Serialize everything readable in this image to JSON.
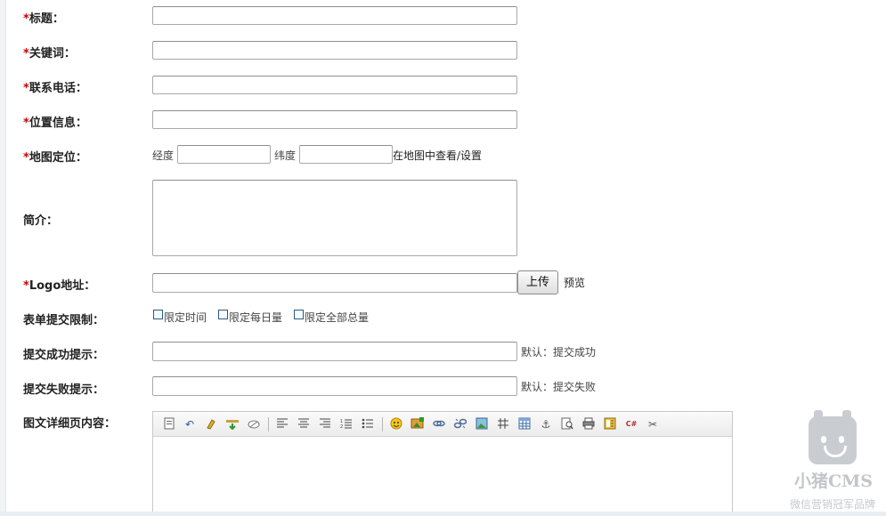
{
  "form": {
    "title": {
      "label": "标题：",
      "required": true,
      "value": ""
    },
    "keywords": {
      "label": "关键词：",
      "required": true,
      "value": ""
    },
    "phone": {
      "label": "联系电话：",
      "required": true,
      "value": ""
    },
    "location": {
      "label": "位置信息：",
      "required": true,
      "value": ""
    },
    "map": {
      "label": "地图定位：",
      "required": true,
      "lng_label": "经度",
      "lat_label": "纬度",
      "lng_value": "",
      "lat_value": "",
      "view_link": "在地图中查看/设置"
    },
    "intro": {
      "label": "简介：",
      "value": ""
    },
    "logo": {
      "label": "Logo地址：",
      "required": true,
      "value": "",
      "upload_label": "上传",
      "preview_label": "预览"
    },
    "submit_limit": {
      "label": "表单提交限制：",
      "options": [
        {
          "label": "限定时间",
          "checked": false
        },
        {
          "label": "限定每日量",
          "checked": false
        },
        {
          "label": "限定全部总量",
          "checked": false
        }
      ]
    },
    "success_tip": {
      "label": "提交成功提示：",
      "value": "",
      "hint": "默认：提交成功"
    },
    "fail_tip": {
      "label": "提交失败提示：",
      "value": "",
      "hint": "默认：提交失败"
    },
    "detail": {
      "label": "图文详细页内容："
    }
  },
  "required_mark": "*",
  "editor_toolbar": [
    "source-icon",
    "undo-icon",
    "clear-format-icon",
    "paste-text-icon",
    "eraser-icon",
    "align-left-icon",
    "align-center-icon",
    "align-right-icon",
    "ordered-list-icon",
    "unordered-list-icon",
    "emoticon-icon",
    "insert-image-icon",
    "link-icon",
    "unlink-icon",
    "image-icon",
    "table-grid-icon",
    "table-icon",
    "anchor-icon",
    "preview-icon",
    "print-icon",
    "template-icon",
    "code-icon",
    "cut-icon"
  ],
  "watermark": {
    "title": "小猪CMS",
    "subtitle": "微信营销冠军品牌"
  },
  "colors": {
    "required": "#cc0000",
    "checkbox_border": "#2a5a8a"
  }
}
